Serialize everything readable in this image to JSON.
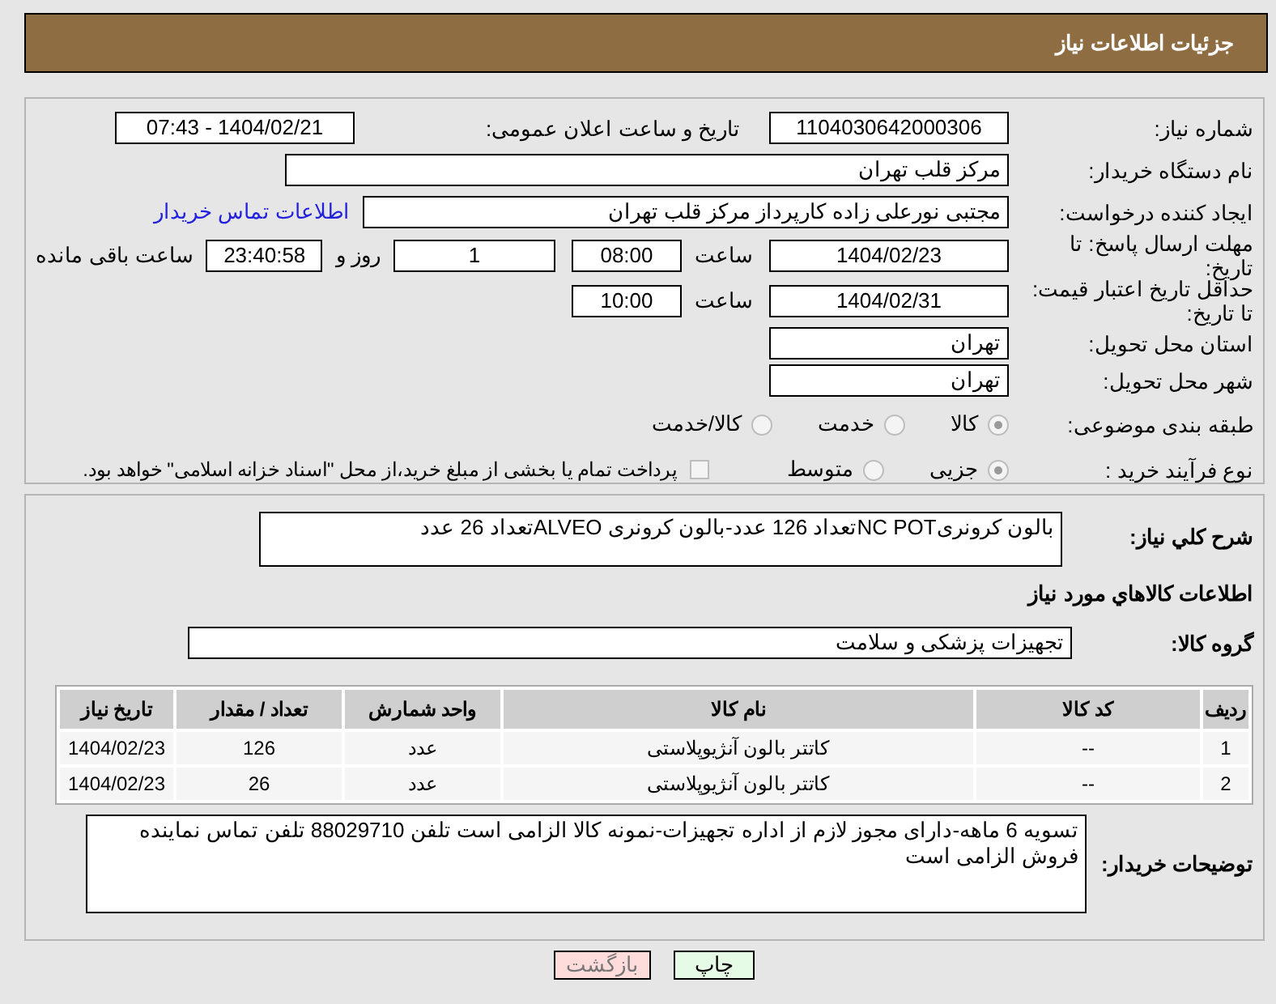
{
  "header": {
    "title": "جزئیات اطلاعات نیاز"
  },
  "form": {
    "need_number": {
      "label": "شماره نیاز:",
      "value": "1104030642000306"
    },
    "announce": {
      "label": "تاریخ و ساعت اعلان عمومی:",
      "value": "1404/02/21 - 07:43"
    },
    "buyer_org": {
      "label": "نام دستگاه خریدار:",
      "value": "مرکز قلب تهران"
    },
    "creator": {
      "label": "ایجاد کننده درخواست:",
      "value": "مجتبی نورعلی زاده کارپرداز مرکز قلب تهران",
      "link": "اطلاعات تماس خریدار"
    },
    "deadline": {
      "label": "مهلت ارسال پاسخ: تا تاریخ:",
      "date": "1404/02/23",
      "time_label": "ساعت",
      "time": "08:00",
      "days": "1",
      "days_label": "روز و",
      "remaining": "23:40:58",
      "remaining_label": "ساعت باقی مانده"
    },
    "validity": {
      "label": "حداقل تاریخ اعتبار قیمت: تا تاریخ:",
      "date": "1404/02/31",
      "time_label": "ساعت",
      "time": "10:00"
    },
    "province": {
      "label": "استان محل تحویل:",
      "value": "تهران"
    },
    "city": {
      "label": "شهر محل تحویل:",
      "value": "تهران"
    },
    "category": {
      "label": "طبقه بندی موضوعی:",
      "options": [
        {
          "label": "کالا",
          "selected": true
        },
        {
          "label": "خدمت",
          "selected": false
        },
        {
          "label": "کالا/خدمت",
          "selected": false
        }
      ]
    },
    "process": {
      "label": "نوع فرآیند خرید :",
      "options": [
        {
          "label": "جزیی",
          "selected": true
        },
        {
          "label": "متوسط",
          "selected": false
        }
      ],
      "treasury": {
        "label": "پرداخت تمام یا بخشی از مبلغ خرید،از محل \"اسناد خزانه اسلامی\" خواهد بود.",
        "checked": false
      }
    }
  },
  "details": {
    "description": {
      "label": "شرح کلي نياز:",
      "value": "بالون کرونریNC POTتعداد 126 عدد-بالون کرونری ALVEOتعداد 26 عدد"
    },
    "goods_heading": "اطلاعات کالاهاي مورد نياز",
    "goods_group": {
      "label": "گروه کالا:",
      "value": "تجهیزات پزشکی و سلامت"
    },
    "table": {
      "columns": [
        "رديف",
        "کد کالا",
        "نام کالا",
        "واحد شمارش",
        "تعداد / مقدار",
        "تاریخ نیاز"
      ],
      "rows": [
        [
          "1",
          "--",
          "کاتتر بالون آنژیوپلاستی",
          "عدد",
          "126",
          "1404/02/23"
        ],
        [
          "2",
          "--",
          "کاتتر بالون آنژیوپلاستی",
          "عدد",
          "26",
          "1404/02/23"
        ]
      ]
    },
    "buyer_notes": {
      "label": "توضیحات خریدار:",
      "value": "تسویه 6 ماهه-دارای مجوز لازم از اداره تجهیزات-نمونه کالا الزامی است تلفن 88029710 تلفن تماس نماینده فروش الزامی است"
    }
  },
  "buttons": [
    {
      "label": "چاپ",
      "kind": "print"
    },
    {
      "label": "بازگشت",
      "kind": "back"
    }
  ]
}
